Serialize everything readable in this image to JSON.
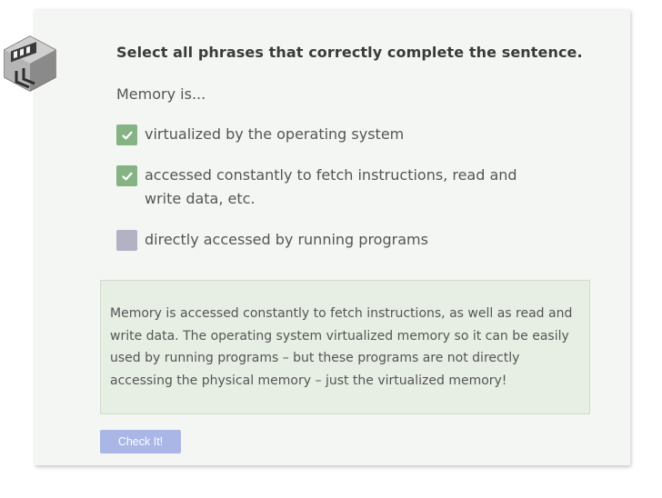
{
  "question": {
    "prompt": "Select all phrases that correctly complete the sentence.",
    "lead": "Memory is..."
  },
  "options": [
    {
      "label": "virtualized by the operating system",
      "checked": true
    },
    {
      "label": "accessed constantly to fetch instructions, read and write data, etc.",
      "checked": true
    },
    {
      "label": "directly accessed by running programs",
      "checked": false
    }
  ],
  "explanation": "Memory is accessed constantly to fetch instructions, as well as read and write data. The operating system virtualized memory so it can be easily used by running programs – but these programs are not directly accessing the physical memory – just the virtualized memory!",
  "check_button": {
    "label": "Check It!"
  },
  "colors": {
    "card_bg": "#f4f6f3",
    "checked": "#85b384",
    "unchecked": "#b3b1c3",
    "explain_bg": "#e7eee4",
    "button_bg": "#a9b6e6"
  },
  "icons": {
    "logo": "memory-module-icon",
    "check": "check-icon"
  }
}
